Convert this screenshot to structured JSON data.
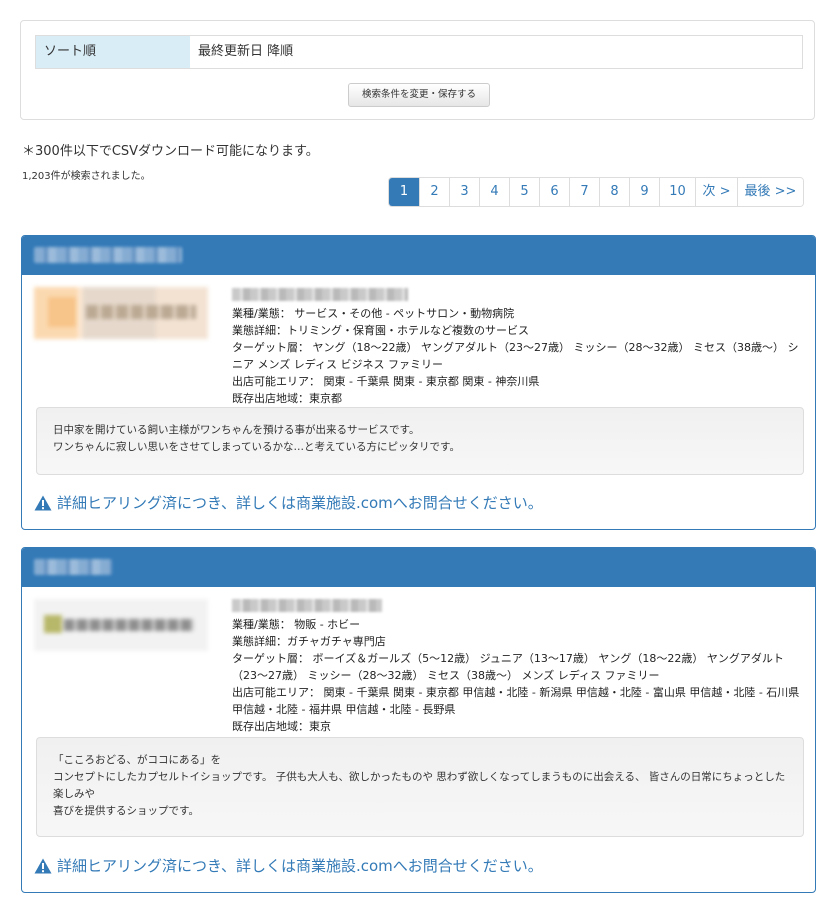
{
  "sort": {
    "label": "ソート順",
    "value": "最終更新日 降順",
    "button": "検索条件を変更・保存する"
  },
  "csv_note": "＊300件以下でCSVダウンロード可能になります。",
  "result_count": "1,203件が検索されました。",
  "pagination": [
    "1",
    "2",
    "3",
    "4",
    "5",
    "6",
    "7",
    "8",
    "9",
    "10",
    "次 >",
    "最後 >>"
  ],
  "listings": [
    {
      "industry": "業種/業態： サービス・その他 - ペットサロン・動物病院",
      "detail": "業態詳細：トリミング・保育園・ホテルなど複数のサービス",
      "target": "ターゲット層： ヤング（18〜22歳） ヤングアダルト（23〜27歳） ミッシー（28〜32歳） ミセス（38歳〜） シニア メンズ レディス ビジネス ファミリー",
      "area": "出店可能エリア： 関東 - 千葉県 関東 - 東京都 関東 - 神奈川県",
      "existing": "既存出店地域：東京都",
      "desc": [
        "日中家を開けている飼い主様がワンちゃんを預ける事が出来るサービスです。",
        "ワンちゃんに寂しい思いをさせてしまっているかな…と考えている方にピッタリです。"
      ],
      "contact": "詳細ヒアリング済につき、詳しくは商業施設.comへお問合せください。"
    },
    {
      "industry": "業種/業態： 物販 - ホビー",
      "detail": "業態詳細：ガチャガチャ専門店",
      "target": "ターゲット層： ボーイズ＆ガールズ（5〜12歳） ジュニア（13〜17歳） ヤング（18〜22歳） ヤングアダルト（23〜27歳） ミッシー（28〜32歳） ミセス（38歳〜） メンズ レディス ファミリー",
      "area": "出店可能エリア： 関東 - 千葉県 関東 - 東京都 甲信越・北陸 - 新潟県 甲信越・北陸 - 富山県 甲信越・北陸 - 石川県 甲信越・北陸 - 福井県 甲信越・北陸 - 長野県",
      "existing": "既存出店地域：東京",
      "desc": [
        "「こころおどる、がココにある」を",
        "コンセプトにしたカプセルトイショップです。 子供も大人も、欲しかったものや 思わず欲しくなってしまうものに出会える、 皆さんの日常にちょっとした楽しみや",
        "喜びを提供するショップです。"
      ],
      "contact": "詳細ヒアリング済につき、詳しくは商業施設.comへお問合せください。"
    }
  ],
  "colors": {
    "accent": "#337ab7",
    "label_bg": "#d9edf7"
  },
  "icons": {
    "contact": "warning-icon"
  }
}
